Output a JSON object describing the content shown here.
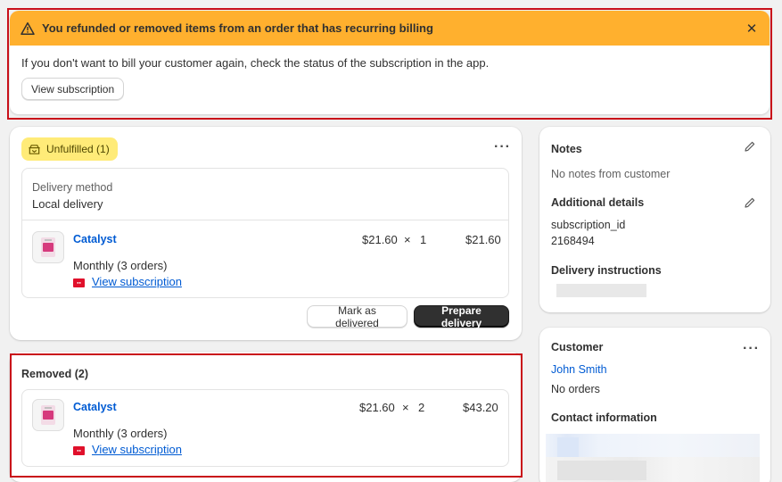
{
  "banner": {
    "title": "You refunded or removed items from an order that has recurring billing",
    "message": "If you don't want to bill your customer again, check the status of the subscription in the app.",
    "button_label": "View subscription"
  },
  "unfulfilled": {
    "badge_label": "Unfulfilled (1)",
    "delivery_method_label": "Delivery method",
    "delivery_method_value": "Local delivery",
    "item": {
      "name": "Catalyst",
      "unit_price": "$21.60",
      "times": "×",
      "quantity": "1",
      "total": "$21.60",
      "plan": "Monthly (3 orders)",
      "subscription_link": "View subscription"
    },
    "mark_delivered_label": "Mark as delivered",
    "prepare_delivery_label": "Prepare delivery"
  },
  "removed": {
    "title": "Removed (2)",
    "item": {
      "name": "Catalyst",
      "unit_price": "$21.60",
      "times": "×",
      "quantity": "2",
      "total": "$43.20",
      "plan": "Monthly (3 orders)",
      "subscription_link": "View subscription"
    }
  },
  "notes": {
    "title": "Notes",
    "value": "No notes from customer",
    "additional_title": "Additional details",
    "attr_key": "subscription_id",
    "attr_value": "2168494",
    "delivery_instructions_title": "Delivery instructions"
  },
  "customer": {
    "title": "Customer",
    "name": "John Smith",
    "orders": "No orders",
    "contact_title": "Contact information"
  },
  "colors": {
    "banner_bg": "#ffb02e",
    "badge_bg": "#ffeb78",
    "link": "#005bd3",
    "highlight_outline": "#c9101a"
  }
}
